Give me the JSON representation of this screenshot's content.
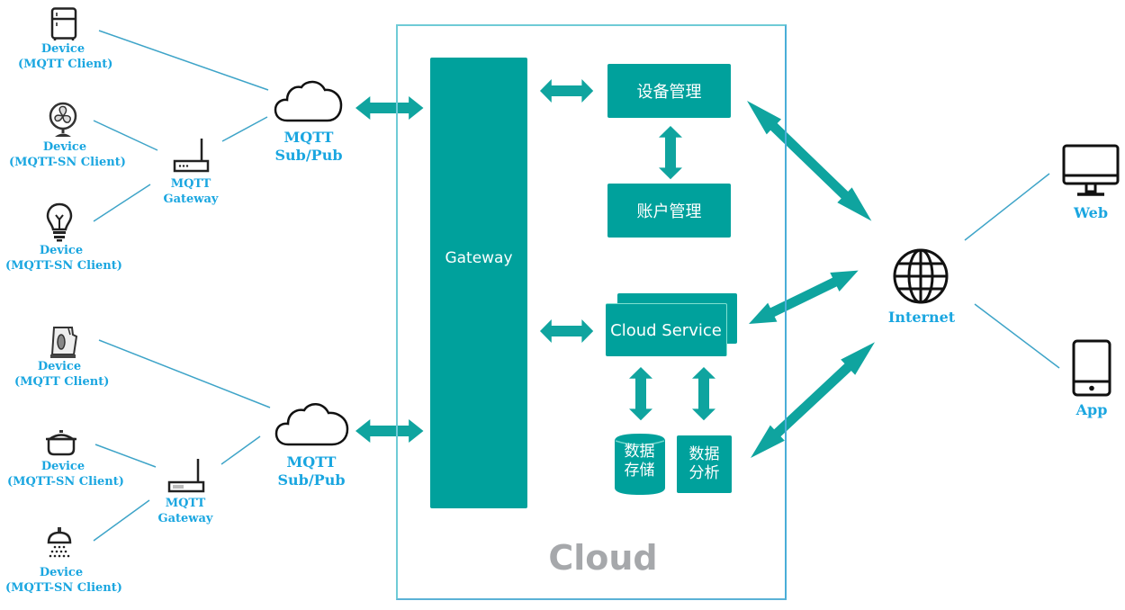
{
  "colors": {
    "accent": "#00a19c",
    "label": "#1aa6e0",
    "line": "#3ea4c8",
    "border": "#6fcbd6",
    "cloud_title": "#a6a8ab"
  },
  "left_top": {
    "devices": [
      {
        "icon": "refrigerator-icon",
        "title": "Device",
        "subtitle": "(MQTT Client)"
      },
      {
        "icon": "fan-icon",
        "title": "Device",
        "subtitle": "(MQTT-SN Client)"
      },
      {
        "icon": "light-bulb-icon",
        "title": "Device",
        "subtitle": "(MQTT-SN Client)"
      }
    ],
    "gateway": {
      "icon": "router-icon",
      "line1": "MQTT",
      "line2": "Gateway"
    },
    "broker": {
      "icon": "cloud-icon",
      "line1": "MQTT",
      "line2": "Sub/Pub"
    }
  },
  "left_bottom": {
    "devices": [
      {
        "icon": "kettle-icon",
        "title": "Device",
        "subtitle": "(MQTT Client)"
      },
      {
        "icon": "cooking-pot-icon",
        "title": "Device",
        "subtitle": "(MQTT-SN Client)"
      },
      {
        "icon": "shower-icon",
        "title": "Device",
        "subtitle": "(MQTT-SN Client)"
      }
    ],
    "gateway": {
      "icon": "router-icon",
      "line1": "MQTT",
      "line2": "Gateway"
    },
    "broker": {
      "icon": "cloud-icon",
      "line1": "MQTT",
      "line2": "Sub/Pub"
    }
  },
  "cloud": {
    "title": "Cloud",
    "gateway": "Gateway",
    "device_management": "设备管理",
    "account_management": "账户管理",
    "cloud_service": "Cloud Service",
    "data_storage": {
      "line1": "数据",
      "line2": "存储"
    },
    "data_analysis": {
      "line1": "数据",
      "line2": "分析"
    }
  },
  "right": {
    "internet": {
      "icon": "globe-icon",
      "label": "Internet"
    },
    "web": {
      "icon": "monitor-icon",
      "label": "Web"
    },
    "app": {
      "icon": "smartphone-icon",
      "label": "App"
    }
  }
}
